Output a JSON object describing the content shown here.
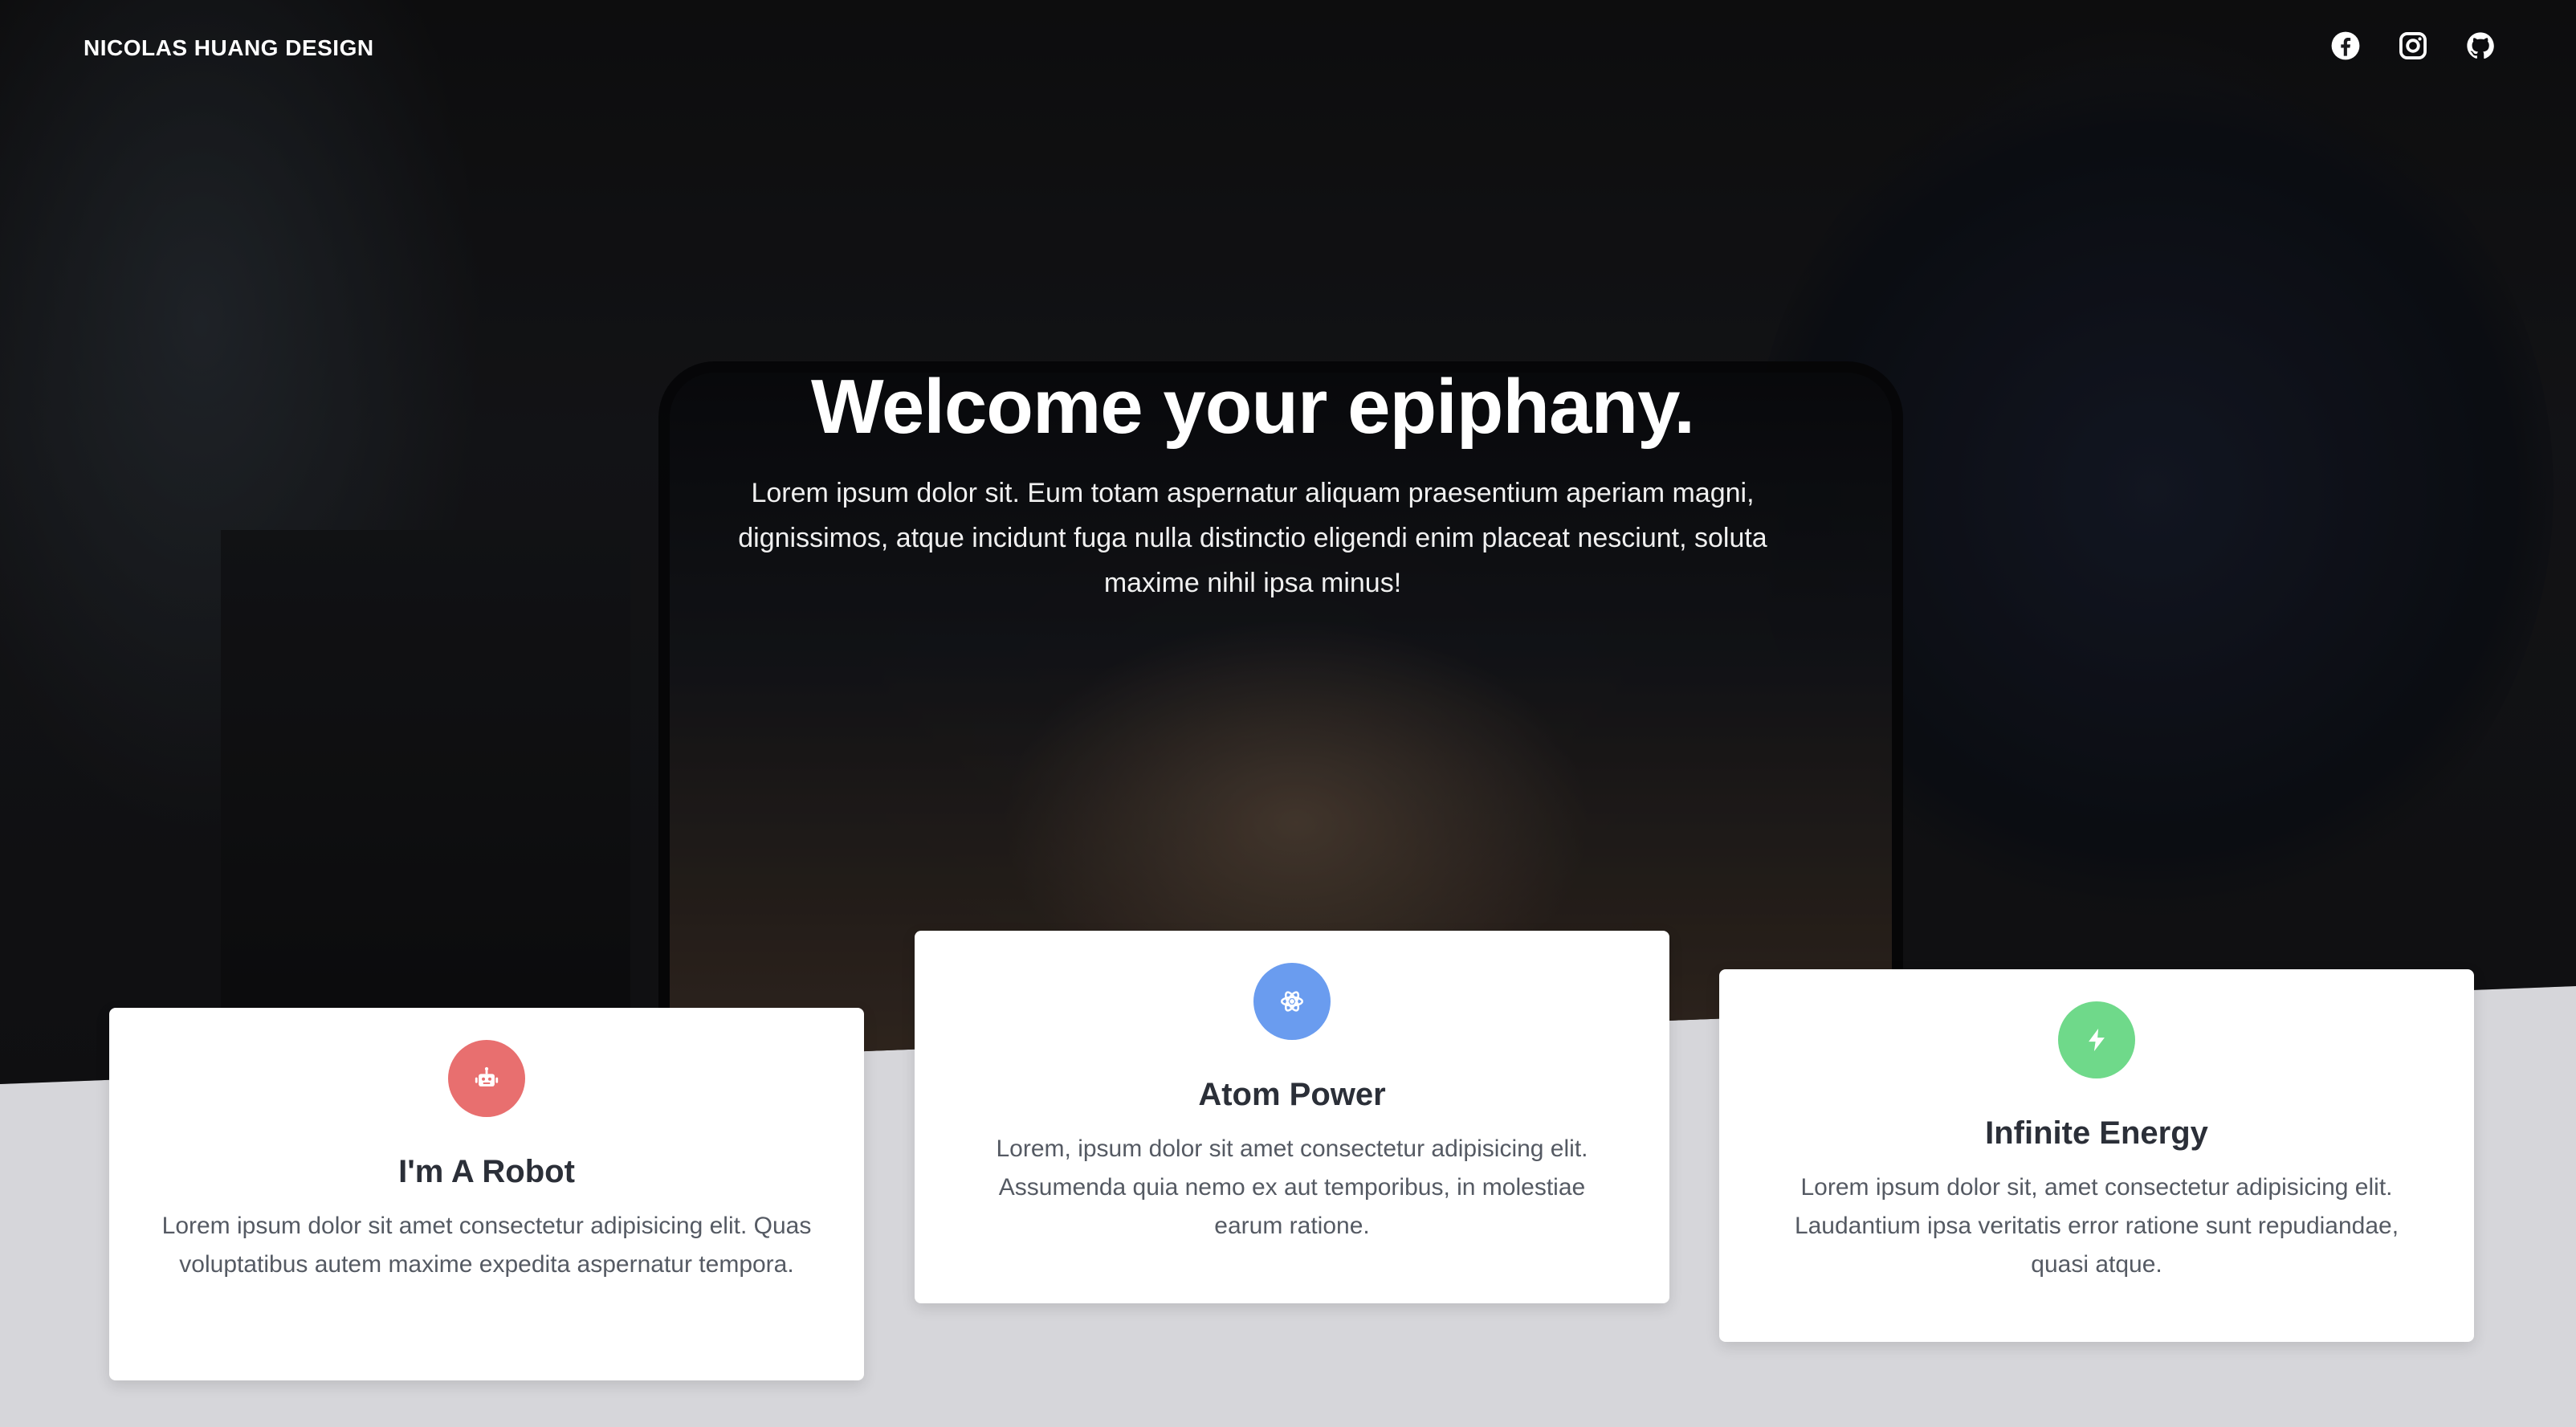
{
  "nav": {
    "brand": "NICOLAS HUANG DESIGN",
    "icons": [
      "facebook-icon",
      "instagram-icon",
      "github-icon"
    ]
  },
  "hero": {
    "title": "Welcome your epiphany.",
    "text": "Lorem ipsum dolor sit. Eum totam aspernatur aliquam praesentium aperiam magni, dignissimos, atque incidunt fuga nulla distinctio eligendi enim placeat nesciunt, soluta maxime nihil ipsa minus!"
  },
  "cards": [
    {
      "title": "I'm A Robot",
      "text": "Lorem ipsum dolor sit amet consectetur adipisicing elit. Quas voluptatibus autem maxime expedita aspernatur tempora.",
      "icon": "robot-icon",
      "color": "#e86f6f"
    },
    {
      "title": "Atom Power",
      "text": "Lorem, ipsum dolor sit amet consectetur adipisicing elit. Assumenda quia nemo ex aut temporibus, in molestiae earum ratione.",
      "icon": "atom-icon",
      "color": "#6a9cef"
    },
    {
      "title": "Infinite Energy",
      "text": "Lorem ipsum dolor sit, amet consectetur adipisicing elit. Laudantium ipsa veritatis error ratione sunt repudiandae, quasi atque.",
      "icon": "bolt-icon",
      "color": "#6fd98a"
    }
  ]
}
